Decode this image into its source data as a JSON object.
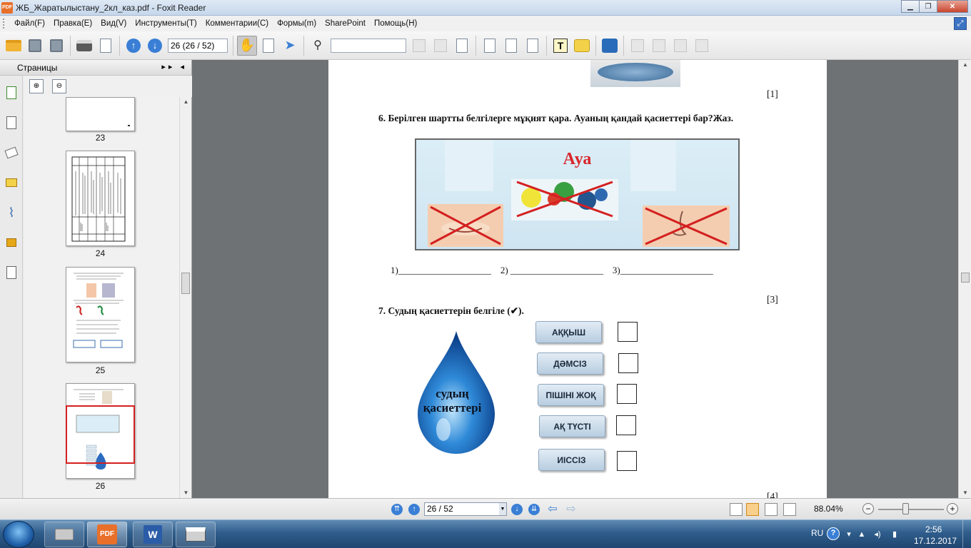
{
  "window": {
    "title": "ЖБ_Жаратылыстану_2кл_каз.pdf - Foxit Reader",
    "app_icon_text": "PDF"
  },
  "menu": {
    "items": [
      "Файл(F)",
      "Правка(E)",
      "Вид(V)",
      "Инструменты(T)",
      "Комментарии(C)",
      "Формы(m)",
      "SharePoint",
      "Помощь(H)"
    ]
  },
  "toolbar": {
    "page_field": "26 (26 / 52)",
    "search_field": ""
  },
  "panel": {
    "title": "Страницы",
    "thumbnails": [
      {
        "label": "23"
      },
      {
        "label": "24"
      },
      {
        "label": "25"
      },
      {
        "label": "26"
      }
    ]
  },
  "document": {
    "mark_top": "[1]",
    "q6": "6.   Берілген шартты белгілерге мұқият қара. Ауаның  қандай қасиеттері бар?Жаз.",
    "air_title": "Ауа",
    "blanks": "1)____________________    2) ____________________    3)____________________",
    "mark_q6": "[3]",
    "q7": "7.   Судың қасиеттерін белгіле (✔).",
    "drop_text": "судың қасиеттері",
    "properties": [
      "АҚҚЫШ",
      "ДӘМСІЗ",
      "ПІШІНІ ЖОҚ",
      "АҚ ТҮСТІ",
      "ИІССІЗ"
    ],
    "mark_bottom": "[4]"
  },
  "status": {
    "page_select": "26 / 52",
    "zoom": "88.04%"
  },
  "taskbar": {
    "lang": "RU",
    "time": "2:56",
    "date": "17.12.2017"
  },
  "colors": {
    "accent": "#3a7fd5",
    "air_title": "#d9262a",
    "selected_thumb": "#d42020"
  }
}
